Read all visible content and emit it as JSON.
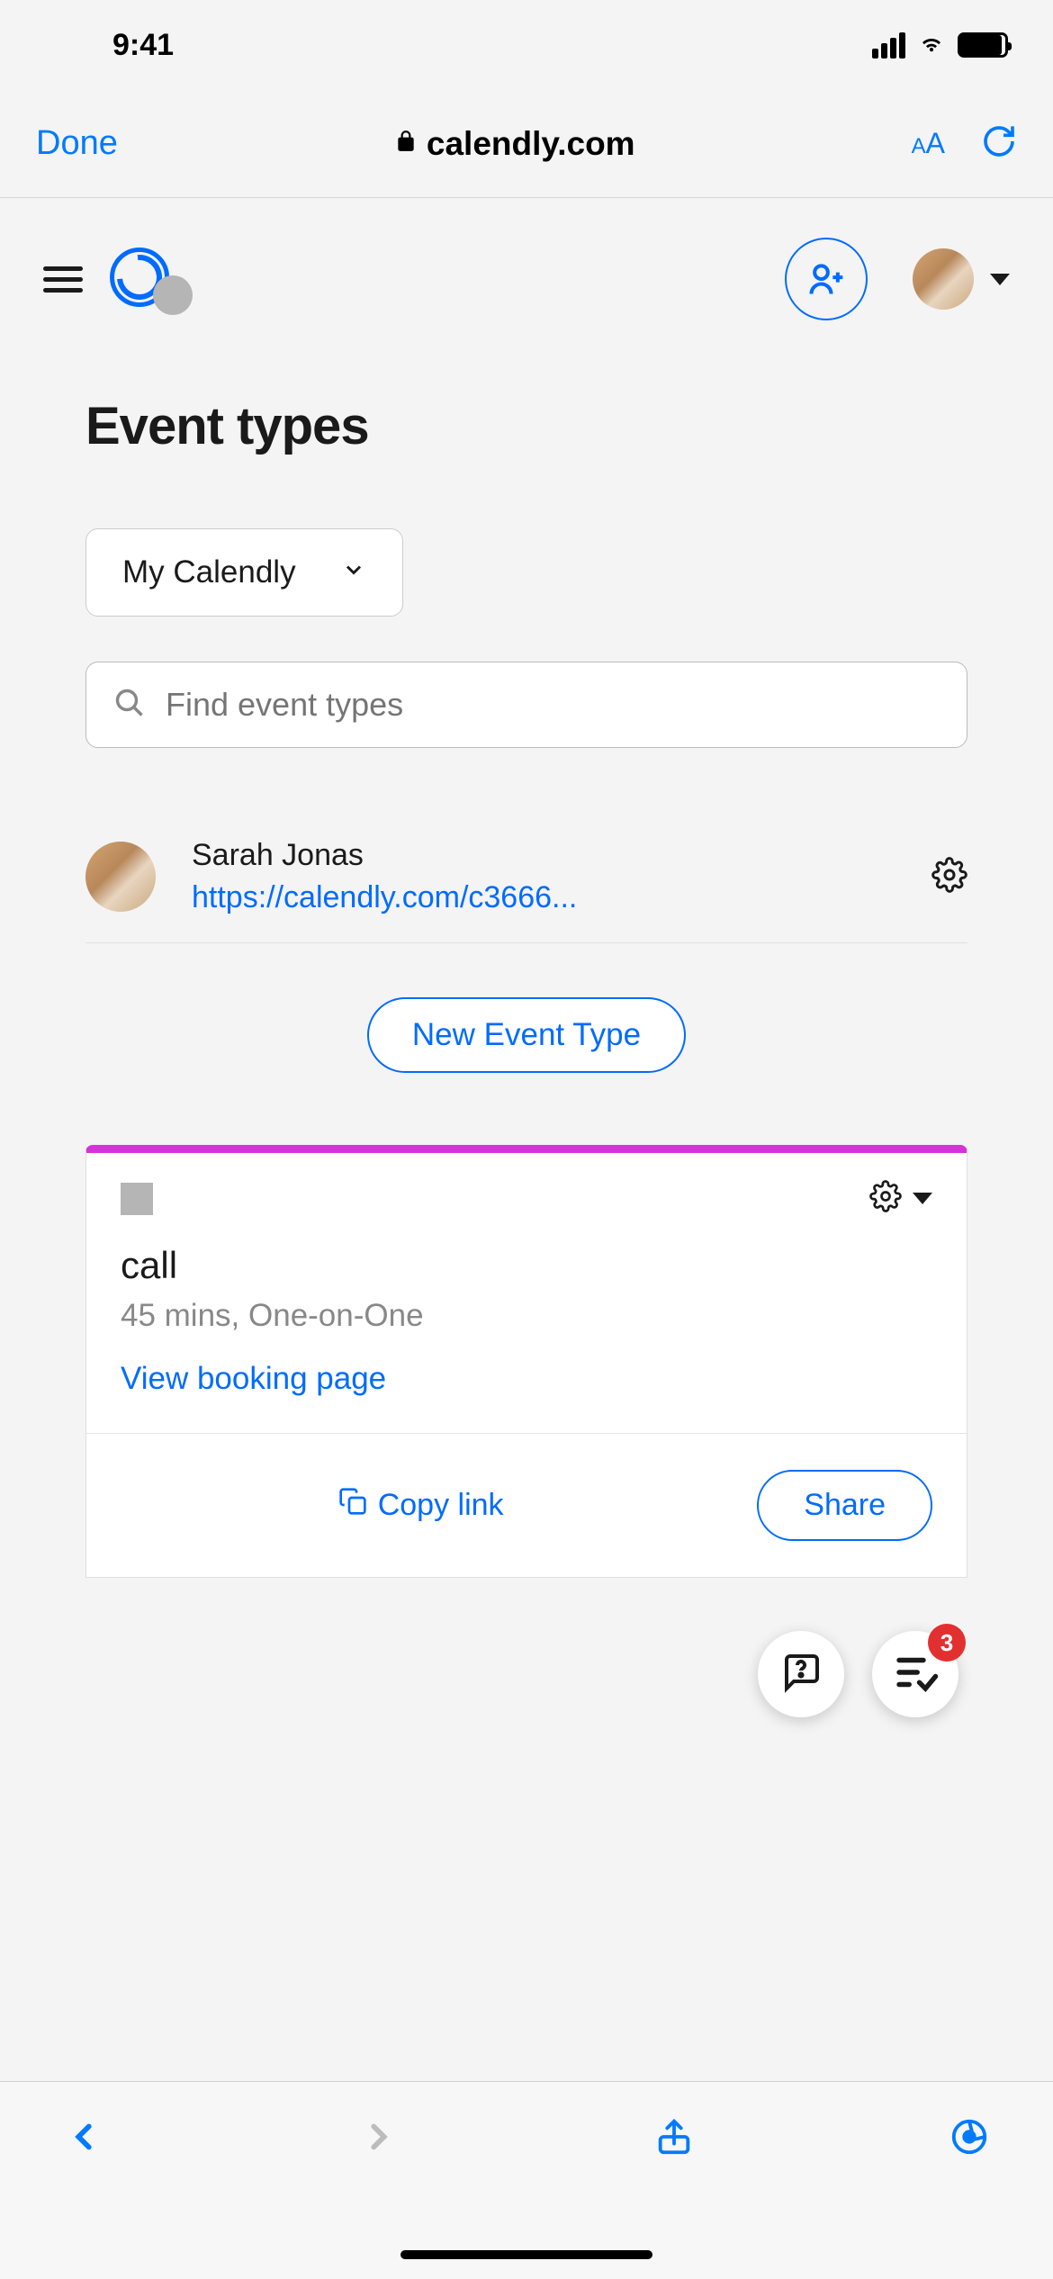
{
  "status": {
    "time": "9:41"
  },
  "browser": {
    "done_label": "Done",
    "url": "calendly.com",
    "text_size_label": "AA"
  },
  "page": {
    "title_label": "Event types",
    "dropdown_label": "My Calendly",
    "search_placeholder": "Find event types",
    "user": {
      "name": "Sarah Jonas",
      "link": "https://calendly.com/c3666..."
    },
    "new_event_label": "New Event Type",
    "event": {
      "title": "call",
      "meta": "45 mins, One-on-One",
      "booking_link_label": "View booking page",
      "copy_label": "Copy link",
      "share_label": "Share",
      "accent_color": "#d633d6"
    },
    "tasks_badge_count": "3"
  }
}
